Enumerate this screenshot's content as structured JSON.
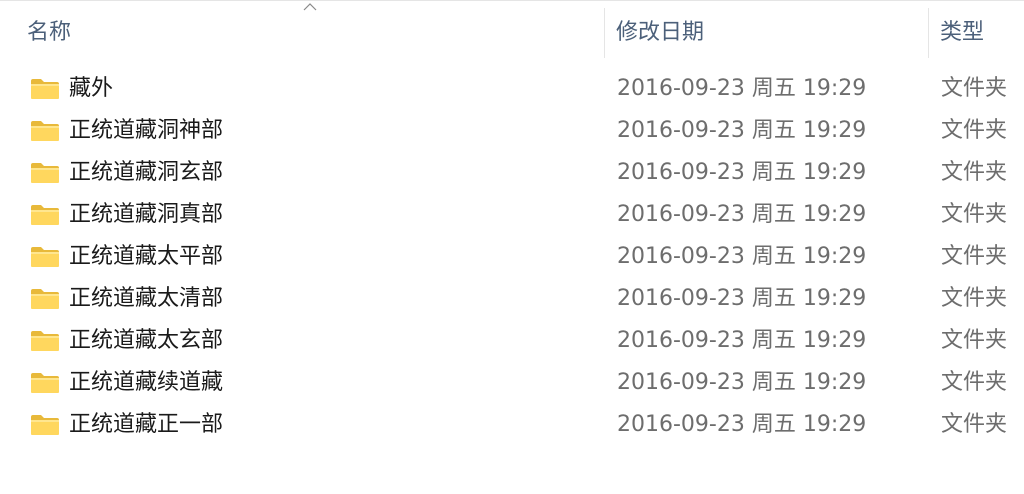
{
  "header": {
    "name_label": "名称",
    "date_label": "修改日期",
    "type_label": "类型"
  },
  "colors": {
    "header_text": "#4c607a",
    "name_text": "#1a1a1a",
    "meta_text": "#6d6d6d",
    "folder_yellow": "#ffd75e"
  },
  "icons": {
    "sort": "chevron-up-icon",
    "folder": "folder-icon"
  },
  "files": [
    {
      "name": "藏外",
      "date": "2016-09-23 周五 19:29",
      "type": "文件夹"
    },
    {
      "name": "正统道藏洞神部",
      "date": "2016-09-23 周五 19:29",
      "type": "文件夹"
    },
    {
      "name": "正统道藏洞玄部",
      "date": "2016-09-23 周五 19:29",
      "type": "文件夹"
    },
    {
      "name": "正统道藏洞真部",
      "date": "2016-09-23 周五 19:29",
      "type": "文件夹"
    },
    {
      "name": "正统道藏太平部",
      "date": "2016-09-23 周五 19:29",
      "type": "文件夹"
    },
    {
      "name": "正统道藏太清部",
      "date": "2016-09-23 周五 19:29",
      "type": "文件夹"
    },
    {
      "name": "正统道藏太玄部",
      "date": "2016-09-23 周五 19:29",
      "type": "文件夹"
    },
    {
      "name": "正统道藏续道藏",
      "date": "2016-09-23 周五 19:29",
      "type": "文件夹"
    },
    {
      "name": "正统道藏正一部",
      "date": "2016-09-23 周五 19:29",
      "type": "文件夹"
    }
  ]
}
